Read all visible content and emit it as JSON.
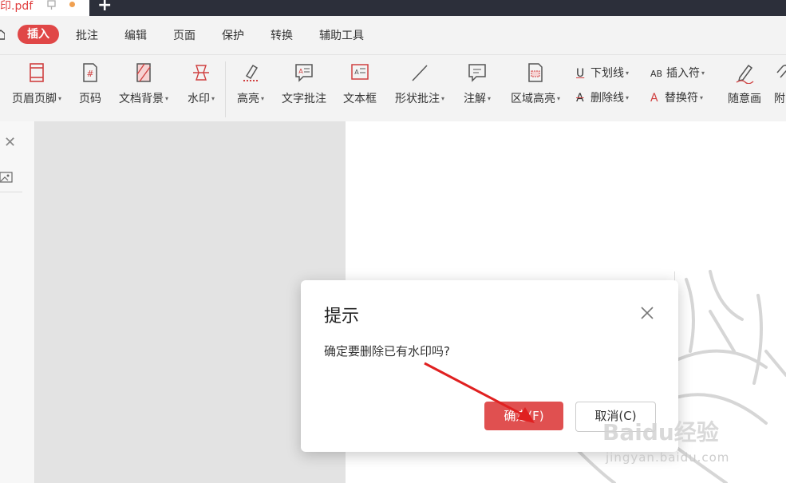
{
  "titlebar": {
    "tab_title": "印.pdf",
    "new_tab": "+"
  },
  "menu": {
    "items": [
      {
        "label": "插入",
        "active": true
      },
      {
        "label": "批注"
      },
      {
        "label": "编辑"
      },
      {
        "label": "页面"
      },
      {
        "label": "保护"
      },
      {
        "label": "转换"
      },
      {
        "label": "辅助工具"
      }
    ]
  },
  "toolbar": {
    "tools": [
      {
        "label": "页眉页脚",
        "icon": "header-footer-icon",
        "has_menu": true
      },
      {
        "label": "页码",
        "icon": "page-number-icon"
      },
      {
        "label": "文档背景",
        "icon": "document-background-icon",
        "has_menu": true
      },
      {
        "label": "水印",
        "icon": "watermark-icon",
        "has_menu": true
      },
      {
        "label": "高亮",
        "icon": "highlight-icon",
        "has_menu": true
      },
      {
        "label": "文字批注",
        "icon": "text-comment-icon"
      },
      {
        "label": "文本框",
        "icon": "text-box-icon"
      },
      {
        "label": "形状批注",
        "icon": "shape-comment-icon",
        "has_menu": true
      },
      {
        "label": "注解",
        "icon": "annotation-icon",
        "has_menu": true
      },
      {
        "label": "区域高亮",
        "icon": "area-highlight-icon",
        "has_menu": true
      },
      {
        "label": "随意画",
        "icon": "freehand-icon"
      },
      {
        "label": "附",
        "icon": "attachment-icon"
      }
    ],
    "small_tools": [
      {
        "label": "下划线",
        "icon": "underline-icon",
        "glyph": "U"
      },
      {
        "label": "删除线",
        "icon": "strikethrough-icon",
        "glyph": "A"
      },
      {
        "label": "插入符",
        "icon": "insert-mark-icon",
        "glyph": "AB"
      },
      {
        "label": "替换符",
        "icon": "replace-mark-icon",
        "glyph": "A"
      }
    ]
  },
  "dialog": {
    "title": "提示",
    "message": "确定要删除已有水印吗?",
    "ok_label": "确定(F)",
    "cancel_label": "取消(C)"
  },
  "watermark_overlay": {
    "brand": "Baidu经验",
    "url": "jingyan.baidu.com"
  },
  "colors": {
    "accent": "#e04747",
    "titlebar": "#2c2f3a",
    "dialog_ok": "#e05050"
  }
}
